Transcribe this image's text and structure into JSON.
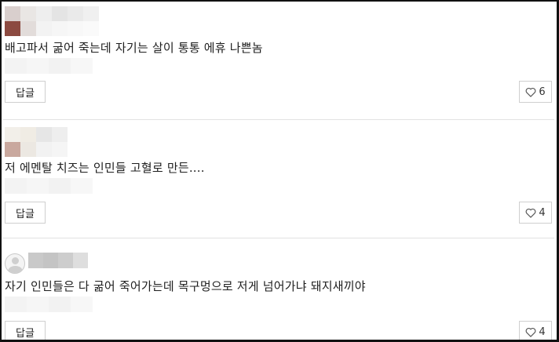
{
  "comments": [
    {
      "text": "배고파서 굶어 죽는데 자기는 살이 통통 에휴 나쁜놈",
      "reply_label": "답글",
      "likes": "6",
      "avatar_icon": "blurred-user-avatar"
    },
    {
      "text": "저 에멘탈 치즈는 인민들 고혈로 만든....",
      "reply_label": "답글",
      "likes": "4",
      "avatar_icon": "blurred-user-avatar"
    },
    {
      "text": "자기 인민들은 다 굶어 죽어가는데 목구멍으로 저게 넘어가냐 돼지새끼야",
      "reply_label": "답글",
      "likes": "4",
      "avatar_icon": "default-user-icon"
    }
  ],
  "icons": {
    "like": "heart-outline-icon"
  },
  "colors": {
    "border": "#cfcfcf",
    "divider": "#e2e2e2",
    "text": "#1e1e1e"
  }
}
